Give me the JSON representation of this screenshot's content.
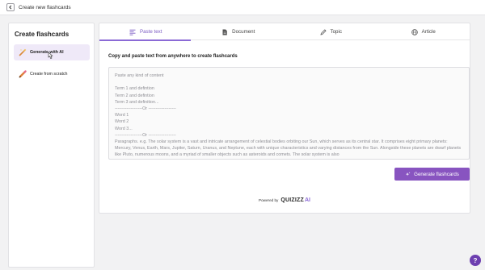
{
  "topbar": {
    "title": "Create new flashcards",
    "back_icon": "chevron-left-icon"
  },
  "sidebar": {
    "title": "Create flashcards",
    "items": [
      {
        "label": "Generate with AI",
        "icon": "sparkle-wand-icon",
        "active": true
      },
      {
        "label": "Create from scratch",
        "icon": "pencil-icon",
        "active": false
      }
    ]
  },
  "tabs": [
    {
      "label": "Paste text",
      "icon": "text-lines-icon",
      "active": true
    },
    {
      "label": "Document",
      "icon": "document-icon",
      "active": false
    },
    {
      "label": "Topic",
      "icon": "pen-icon",
      "active": false
    },
    {
      "label": "Article",
      "icon": "globe-icon",
      "active": false
    }
  ],
  "main": {
    "prompt": "Copy and paste text from anywhere to create flashcards",
    "placeholder": "Paste any kind of content\n\nTerm 1 and defintion\nTerm 2 and defintion\nTerm 3 and definition...\n-------------------Or -------------------\nWord 1\nWord 2\nWord 3...\n-------------------Or -------------------\nParagraphs. e.g. The solar system is a vast and intricate arrangement of celestial bodies orbiting our Sun, which serves as its central star. It comprises eight primary planets: Mercury, Venus, Earth, Mars, Jupiter, Saturn, Uranus, and Neptune, each with unique characteristics and varying distances from the Sun. Alongside these planets are dwarf planets like Pluto, numerous moons, and a myriad of smaller objects such as asteroids and comets. The solar system is also",
    "generate_label": "Generate flashcards",
    "powered_by": "Powered by",
    "brand": "QUIZIZZ",
    "brand_ai": "AI"
  },
  "help": {
    "label": "?"
  },
  "colors": {
    "accent": "#8854c0",
    "tab_active": "#7c5cc4",
    "active_bg": "#efe9f8",
    "help_bg": "#6d3fb0"
  }
}
